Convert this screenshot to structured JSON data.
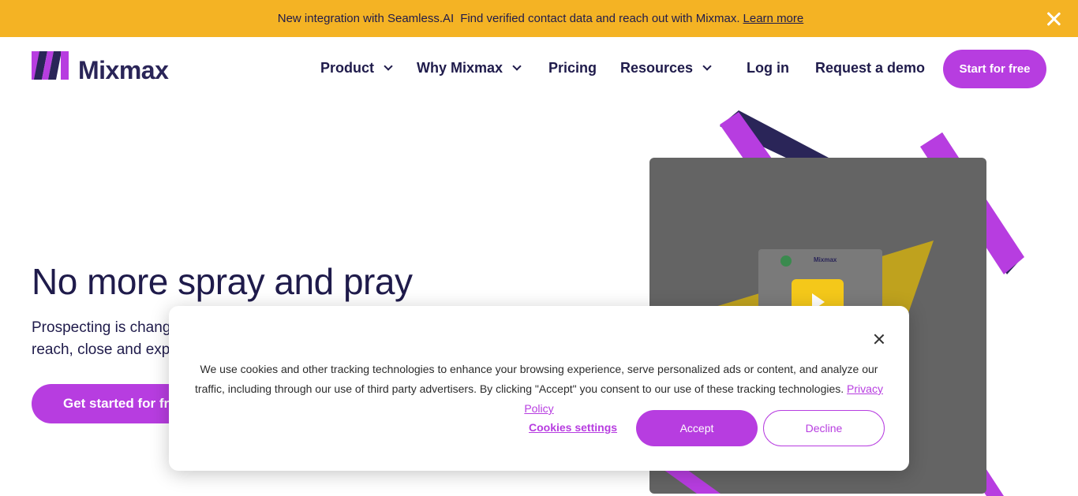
{
  "banner": {
    "icon_left": "",
    "text_part1": "New integration with Seamless.AI",
    "icon_mid": "",
    "text_part2": "Find verified contact data and reach out with Mixmax.",
    "learn_more": "Learn more"
  },
  "nav": {
    "logo_text": "Mixmax",
    "items": [
      {
        "label": "Product"
      },
      {
        "label": "Why Mixmax"
      },
      {
        "label": "Pricing"
      },
      {
        "label": "Resources"
      },
      {
        "label": "Log in"
      },
      {
        "label": "Request a demo"
      }
    ],
    "cta": "Start for free"
  },
  "hero": {
    "title": "No more spray and pray",
    "subtitle_line1": "Prospecting is chang",
    "subtitle_line2": "reach, close and exp",
    "cta": "Get started for free"
  },
  "media": {
    "mini_logo_text": "Mixmax"
  },
  "cookie": {
    "text": "We use cookies and other tracking technologies to enhance your browsing experience, serve personalized ads or content, and analyze our traffic, including through our use of third party advertisers. By clicking \"Accept\" you consent to our use of these tracking technologies.",
    "policy_link": "Privacy Policy",
    "settings": "Cookies settings",
    "accept": "Accept",
    "decline": "Decline"
  },
  "colors": {
    "brand_purple": "#b73de0",
    "navy": "#1f1b4b",
    "banner_yellow": "#f4b324"
  }
}
